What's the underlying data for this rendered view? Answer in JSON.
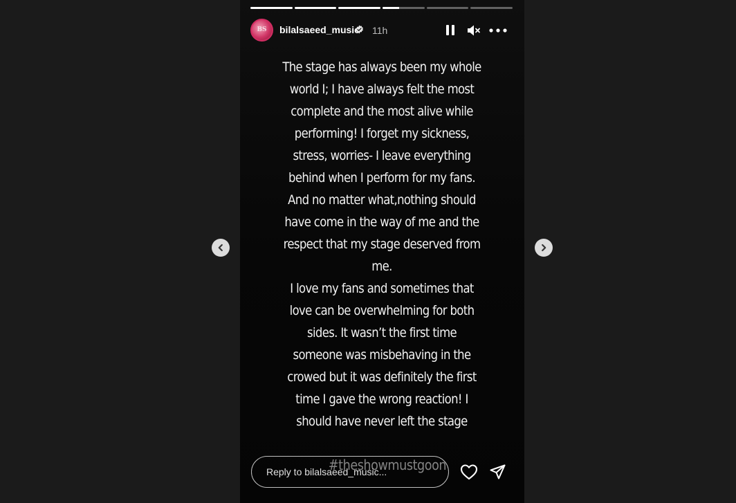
{
  "story": {
    "progress": [
      1,
      1,
      1,
      0.4,
      0,
      0
    ],
    "author": {
      "avatar_text": "BS",
      "username": "bilalsaeed_music",
      "verified": true,
      "time": "11h"
    },
    "icons": {
      "avatar": "avatar-icon",
      "verified": "verified-badge-icon",
      "pause": "pause-icon",
      "mute": "mute-icon",
      "more": "more-options-icon",
      "heart": "heart-icon",
      "send": "send-icon",
      "prev": "chevron-left-icon",
      "next": "chevron-right-icon"
    },
    "text_lines": [
      "The stage has always been my whole",
      "world I; I have always felt the most",
      "complete and the most alive while",
      "performing! I forget my sickness,",
      "stress, worries- I leave everything",
      "behind when I perform for my fans.",
      "And no matter what,nothing should",
      "have come in the way of me and the",
      "respect that my stage deserved from",
      "me.",
      "I love my fans and sometimes that",
      "love can be overwhelming for both",
      "sides. It wasn’t the first time",
      "someone was misbehaving in the",
      "crowed but it was definitely the first",
      "time I gave the wrong reaction! I",
      "should have never left the stage"
    ],
    "hashtag": "#theshowmustgoon",
    "reply_placeholder": "Reply to bilalsaeed_music..."
  }
}
